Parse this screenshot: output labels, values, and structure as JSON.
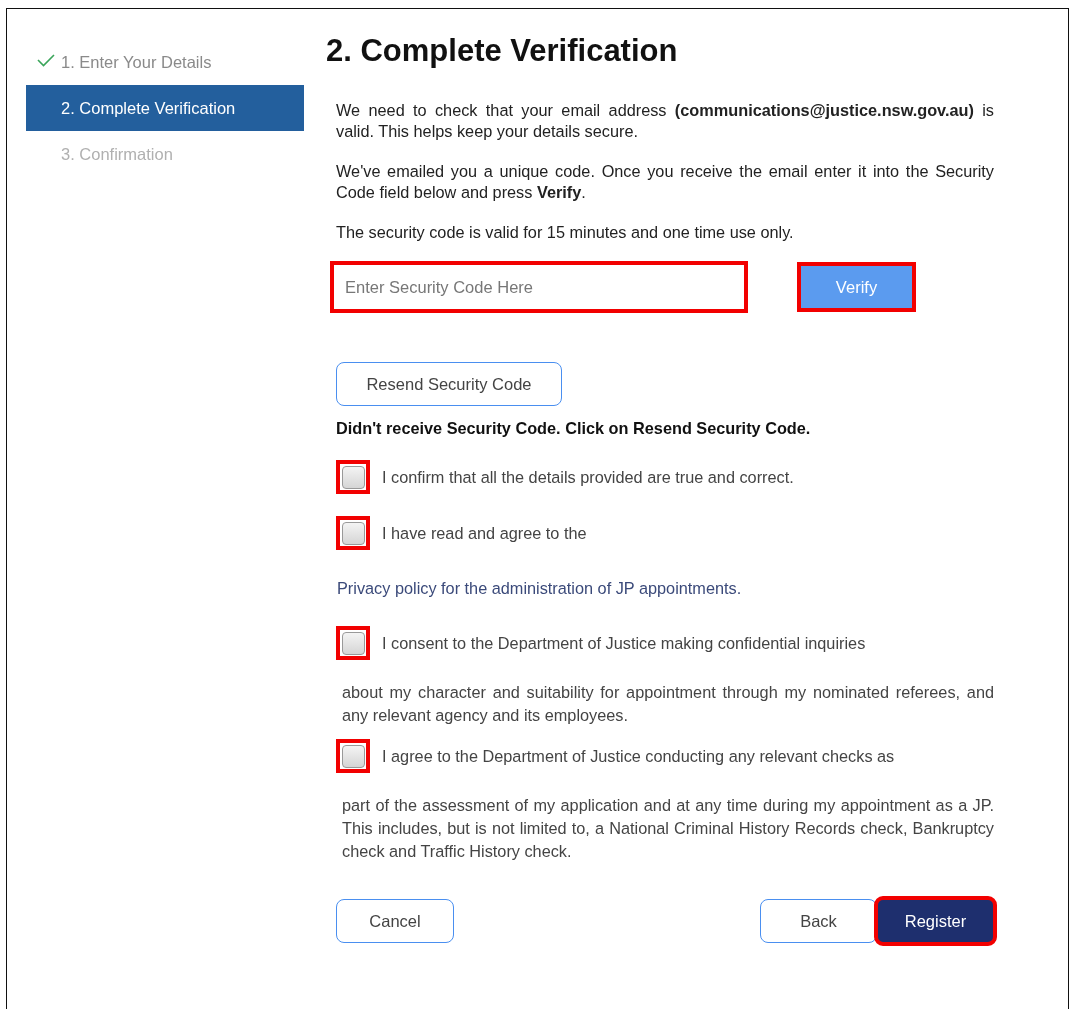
{
  "steps": [
    {
      "label": "1. Enter Your Details",
      "completed": true,
      "selected": false
    },
    {
      "label": "2. Complete Verification",
      "completed": false,
      "selected": true
    },
    {
      "label": "3. Confirmation",
      "completed": false,
      "selected": false
    }
  ],
  "heading": "2. Complete Verification",
  "paragraphs": [
    "We need to check that your email address **(communications@justice.nsw.gov.au)** is valid. This helps keep your details secure.",
    "We've emailed you a unique code. Once you receive the email enter it into the Security Code field below and press **Verify**.",
    "The security code is valid for 15 minutes and one time use only."
  ],
  "security_code": {
    "placeholder": "Enter Security Code Here",
    "highlighted": true
  },
  "verify_button": {
    "label": "Verify",
    "highlighted": true
  },
  "resend_button": {
    "label": "Resend Security Code"
  },
  "resend_note": "Didn't receive Security Code. Click on Resend Security Code.",
  "declarations": [
    {
      "label": "I confirm that all the details provided are true and correct.",
      "checked": false,
      "highlighted": true
    },
    {
      "label": "I have read and agree to the",
      "link": "Privacy policy for the administration of JP appointments.",
      "checked": false,
      "highlighted": true
    },
    {
      "label": "I consent to the Department of Justice making confidential inquiries",
      "continuation": "about my character and suitability for appointment through my nominated referees, and any relevant agency and its employees.",
      "checked": false,
      "highlighted": true
    },
    {
      "label": "I agree to the Department of Justice conducting any relevant checks as",
      "continuation": "part of the assessment of my application and at any time during my appointment as a JP. This includes, but is not limited to, a National Criminal History Records check, Bankruptcy check and Traffic History check.",
      "checked": false,
      "highlighted": true
    }
  ],
  "buttons": [
    {
      "label": "Cancel",
      "kind": "outline",
      "highlighted": false
    },
    {
      "label": "Back",
      "kind": "outline",
      "highlighted": false
    },
    {
      "label": "Register",
      "kind": "primary",
      "highlighted": true
    }
  ]
}
